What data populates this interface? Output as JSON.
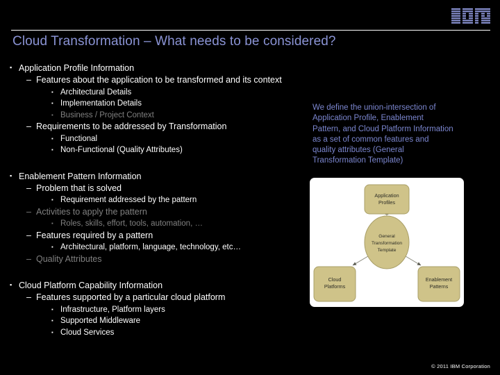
{
  "brand": {
    "logo": "ibm-logo",
    "logo_color": "#8a93d4"
  },
  "title": "Cloud Transformation – What needs to be considered?",
  "colors": {
    "background": "#000000",
    "title": "#8a93d4",
    "body_text": "#ffffff",
    "dim_text": "#808080",
    "callout_text": "#7b86cf",
    "node_fill": "#cfc389",
    "node_border": "#a99f68",
    "panel": "#ffffff"
  },
  "sections": [
    {
      "heading": "Application Profile Information",
      "dim": false,
      "items": [
        {
          "level": 2,
          "text": "Features about the application to be transformed and its context",
          "dim": false
        },
        {
          "level": 3,
          "text": "Architectural Details",
          "dim": false
        },
        {
          "level": 3,
          "text": "Implementation Details",
          "dim": false
        },
        {
          "level": 3,
          "text": "Business / Project Context",
          "dim": true
        },
        {
          "level": 2,
          "text": "Requirements to be addressed by Transformation",
          "dim": false
        },
        {
          "level": 3,
          "text": "Functional",
          "dim": false
        },
        {
          "level": 3,
          "text": "Non-Functional (Quality Attributes)",
          "dim": false
        }
      ]
    },
    {
      "heading": "Enablement Pattern Information",
      "dim": false,
      "items": [
        {
          "level": 2,
          "text": "Problem that is solved",
          "dim": false
        },
        {
          "level": 3,
          "text": "Requirement addressed by the pattern",
          "dim": false
        },
        {
          "level": 2,
          "text": "Activities to apply the pattern",
          "dim": true
        },
        {
          "level": 3,
          "text": "Roles, skills, effort, tools, automation, …",
          "dim": true
        },
        {
          "level": 2,
          "text": "Features required by a pattern",
          "dim": false
        },
        {
          "level": 3,
          "text": "Architectural, platform, language, technology, etc…",
          "dim": false
        },
        {
          "level": 2,
          "text": "Quality Attributes",
          "dim": true
        }
      ]
    },
    {
      "heading": "Cloud Platform Capability Information",
      "dim": false,
      "items": [
        {
          "level": 2,
          "text": "Features supported by a particular cloud platform",
          "dim": false
        },
        {
          "level": 3,
          "text": "Infrastructure, Platform layers",
          "dim": false
        },
        {
          "level": 3,
          "text": "Supported Middleware",
          "dim": false
        },
        {
          "level": 3,
          "text": "Cloud Services",
          "dim": false
        }
      ]
    }
  ],
  "callout": {
    "lines": [
      "We define the union-intersection of",
      "Application Profile, Enablement",
      "Pattern, and Cloud Platform Information",
      "as a set of common features and",
      "quality attributes (General",
      "Transformation Template)"
    ]
  },
  "diagram": {
    "center": {
      "name": "general-transformation-template",
      "lines": [
        "General",
        "Transformation",
        "Template"
      ]
    },
    "nodes": [
      {
        "name": "application-profiles",
        "lines": [
          "Application",
          "Profiles"
        ],
        "position": "top"
      },
      {
        "name": "cloud-platforms",
        "lines": [
          "Cloud",
          "Platforms"
        ],
        "position": "bottom-left"
      },
      {
        "name": "enablement-patterns",
        "lines": [
          "Enablement",
          "Patterns"
        ],
        "position": "bottom-right"
      }
    ]
  },
  "footer": "© 2011 IBM Corporation",
  "markers": {
    "level1": "▪",
    "level2": "–",
    "level3": "▪"
  }
}
